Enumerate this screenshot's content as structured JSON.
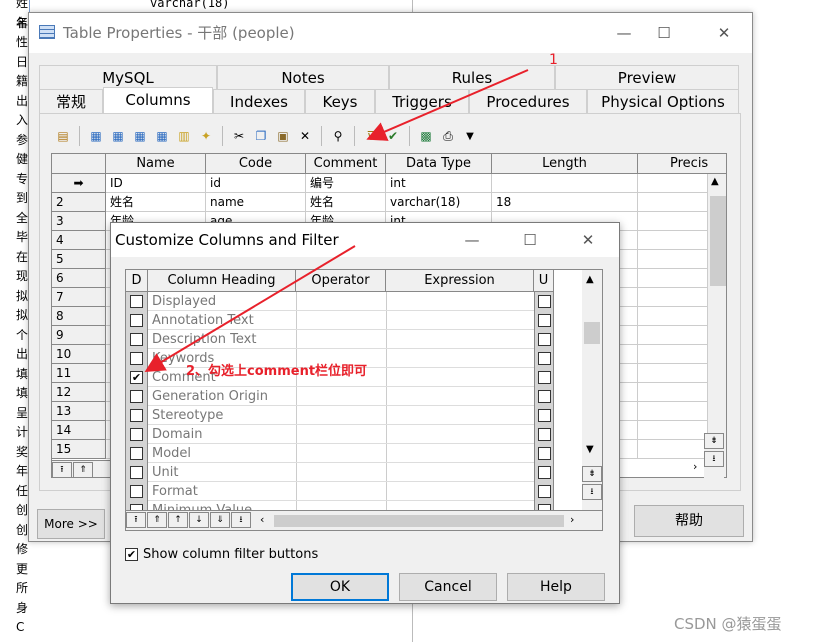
{
  "background": {
    "left_chars": [
      "姓名",
      "年",
      "性",
      "日",
      "籍",
      "出",
      "入",
      "参",
      "健",
      "专",
      "到",
      "全",
      "毕",
      "在",
      "现",
      "拟",
      "拟",
      "个",
      "出",
      "填",
      "填",
      "呈",
      "计",
      "奖",
      "年",
      "任",
      "创",
      "创",
      "修",
      "更",
      "所",
      "身",
      "C"
    ],
    "top_text": "varchar(18)"
  },
  "table_window": {
    "title": "Table Properties - 干部 (people)",
    "caption_buttons": {
      "minimize": "—",
      "maximize": "☐",
      "close": "✕"
    },
    "tabs_top": [
      "MySQL",
      "Notes",
      "Rules",
      "Preview"
    ],
    "tabs_bottom": [
      "常规",
      "Columns",
      "Indexes",
      "Keys",
      "Triggers",
      "Procedures",
      "Physical Options"
    ],
    "active_tab": "Columns",
    "grid": {
      "headers": [
        "Name",
        "Code",
        "Comment",
        "Data Type",
        "Length",
        "Precis"
      ],
      "rows": [
        {
          "num": "➡",
          "name": "ID",
          "code": "id",
          "comment": "编号",
          "type": "int",
          "length": ""
        },
        {
          "num": "2",
          "name": "姓名",
          "code": "name",
          "comment": "姓名",
          "type": "varchar(18)",
          "length": "18"
        },
        {
          "num": "3",
          "name": "年龄",
          "code": "age",
          "comment": "年龄",
          "type": "int",
          "length": ""
        },
        {
          "num": "4"
        },
        {
          "num": "5"
        },
        {
          "num": "6"
        },
        {
          "num": "7"
        },
        {
          "num": "8"
        },
        {
          "num": "9"
        },
        {
          "num": "10"
        },
        {
          "num": "11"
        },
        {
          "num": "12"
        },
        {
          "num": "13"
        },
        {
          "num": "14"
        },
        {
          "num": "15"
        }
      ]
    },
    "more_button": "More >>",
    "help_button": "帮助"
  },
  "filter_dialog": {
    "title": "Customize Columns and Filter",
    "caption_buttons": {
      "minimize": "—",
      "maximize": "☐",
      "close": "✕"
    },
    "headers": [
      "D",
      "Column Heading",
      "Operator",
      "Expression",
      "U"
    ],
    "rows": [
      {
        "label": "Displayed",
        "checked": false
      },
      {
        "label": "Annotation Text",
        "checked": false
      },
      {
        "label": "Description Text",
        "checked": false
      },
      {
        "label": "Keywords",
        "checked": false
      },
      {
        "label": "Comment",
        "checked": true
      },
      {
        "label": "Generation Origin",
        "checked": false
      },
      {
        "label": "Stereotype",
        "checked": false
      },
      {
        "label": "Domain",
        "checked": false
      },
      {
        "label": "Model",
        "checked": false
      },
      {
        "label": "Unit",
        "checked": false
      },
      {
        "label": "Format",
        "checked": false
      },
      {
        "label": "Minimum Value",
        "checked": false
      }
    ],
    "show_filter_label": "Show column filter buttons",
    "show_filter_checked": true,
    "ok": "OK",
    "cancel": "Cancel",
    "help": "Help"
  },
  "annotations": {
    "step1": "1",
    "step2": "2、勾选上comment栏位即可",
    "color": "#e8212b"
  },
  "watermark": "CSDN @猿蛋蛋"
}
